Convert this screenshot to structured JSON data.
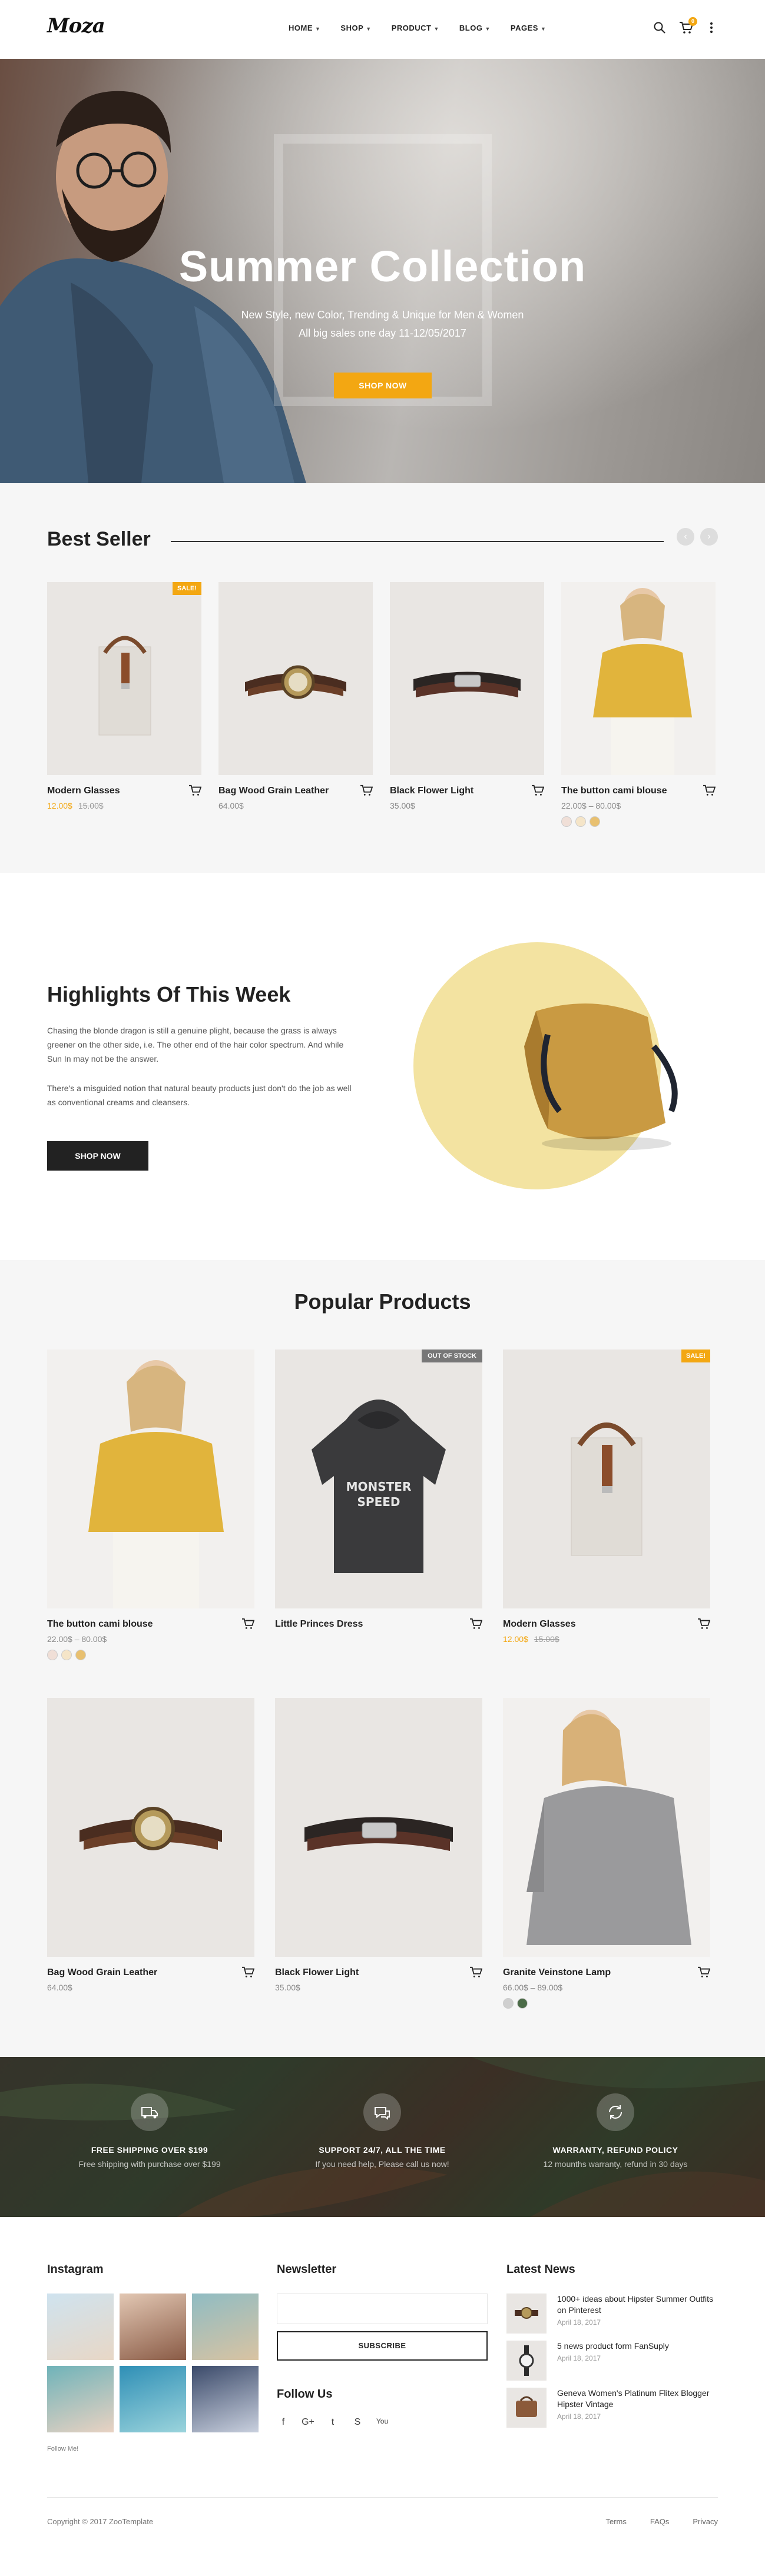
{
  "header": {
    "logo": "Moza",
    "nav": [
      {
        "label": "HOME"
      },
      {
        "label": "SHOP"
      },
      {
        "label": "PRODUCT"
      },
      {
        "label": "BLOG"
      },
      {
        "label": "PAGES"
      }
    ],
    "cart_count": "0"
  },
  "hero": {
    "title": "Summer Collection",
    "subtitle_1": "New Style, new Color, Trending & Unique for Men & Women",
    "subtitle_2": "All big sales one day 11-12/05/2017",
    "button": "SHOP NOW"
  },
  "best_seller": {
    "title": "Best Seller",
    "products": [
      {
        "name": "Modern Glasses",
        "price": "12.00$",
        "old_price": "15.00$",
        "badge": "SALE!"
      },
      {
        "name": "Bag Wood Grain Leather",
        "price": "64.00$"
      },
      {
        "name": "Black Flower Light",
        "price": "35.00$"
      },
      {
        "name": "The button cami blouse",
        "price": "22.00$ – 80.00$"
      }
    ]
  },
  "highlights": {
    "title": "Highlights Of This Week",
    "p1": "Chasing the blonde dragon is still a genuine plight, because the grass is always greener on the other side, i.e. The other end of the hair color spectrum. And while Sun In may not be the answer.",
    "p2": "There's a misguided notion that natural beauty products just don't do the job as well as conventional creams and cleansers.",
    "button": "SHOP NOW"
  },
  "popular": {
    "title": "Popular Products",
    "products": [
      {
        "name": "The button cami blouse",
        "price": "22.00$ – 80.00$"
      },
      {
        "name": "Little Princes Dress",
        "badge": "OUT OF STOCK",
        "hoodie_text_1": "MONSTER",
        "hoodie_text_2": "SPEED"
      },
      {
        "name": "Modern Glasses",
        "price": "12.00$",
        "old_price": "15.00$",
        "badge": "SALE!"
      },
      {
        "name": "Bag Wood Grain Leather",
        "price": "64.00$"
      },
      {
        "name": "Black Flower Light",
        "price": "35.00$"
      },
      {
        "name": "Granite Veinstone Lamp",
        "price": "66.00$ – 89.00$"
      }
    ]
  },
  "features": [
    {
      "title": "FREE SHIPPING OVER $199",
      "sub": "Free shipping with purchase over $199"
    },
    {
      "title": "SUPPORT 24/7, ALL THE TIME",
      "sub": "If you need help, Please call us now!"
    },
    {
      "title": "WARRANTY, REFUND POLICY",
      "sub": "12 mounths warranty, refund in 30 days"
    }
  ],
  "footer": {
    "instagram_title": "Instagram",
    "follow_me": "Follow Me!",
    "newsletter_title": "Newsletter",
    "subscribe": "SUBSCRIBE",
    "follow_us": "Follow Us",
    "social": [
      "f",
      "G+",
      "t",
      "S",
      "You"
    ],
    "news_title": "Latest News",
    "news": [
      {
        "title": "1000+ ideas about Hipster Summer Outfits on Pinterest",
        "date": "April 18, 2017"
      },
      {
        "title": "5 news product form FanSuply",
        "date": "April 18, 2017"
      },
      {
        "title": "Geneva Women's Platinum Flitex Blogger Hipster Vintage",
        "date": "April 18, 2017"
      }
    ],
    "copyright": "Copyright © 2017 ZooTemplate",
    "links": [
      "Terms",
      "FAQs",
      "Privacy"
    ]
  },
  "colors": {
    "accent": "#f3a712",
    "dark": "#222222",
    "light_bg": "#f6f6f6"
  }
}
